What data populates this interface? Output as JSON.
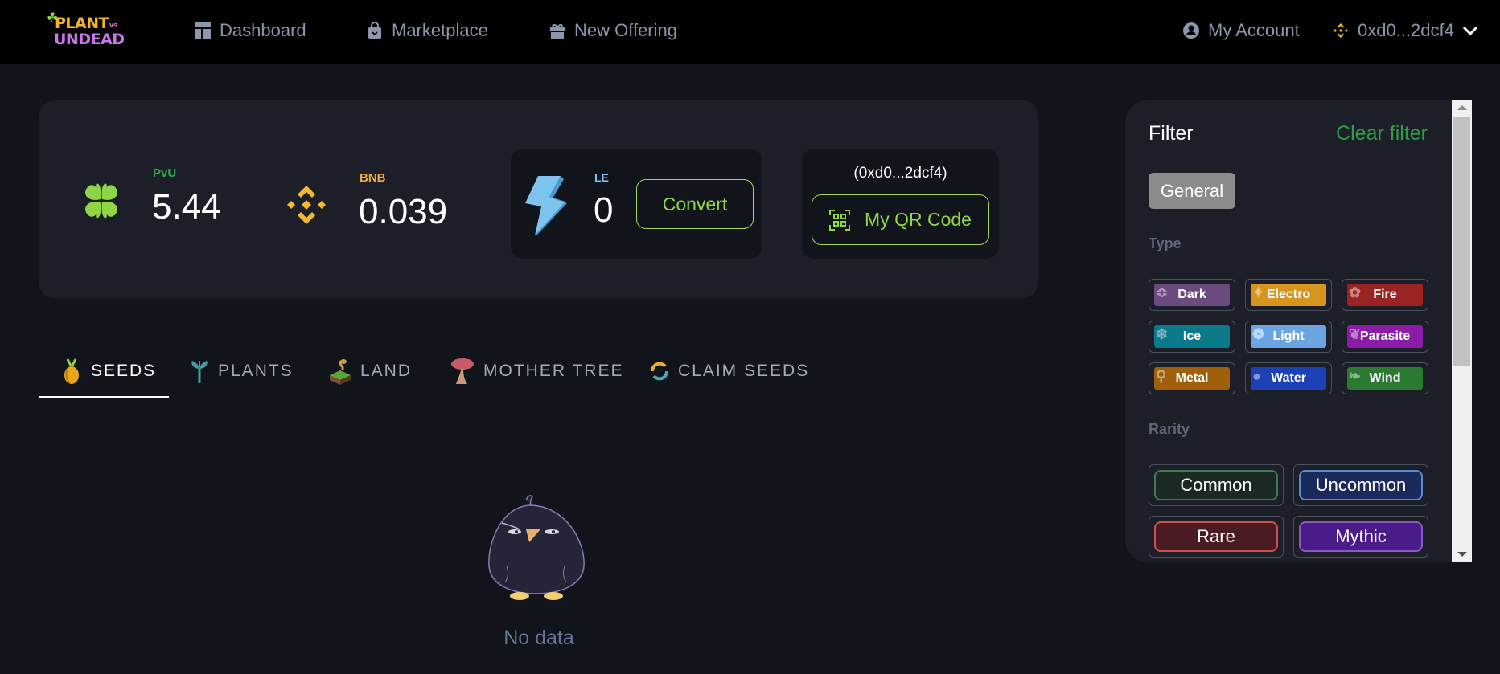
{
  "header": {
    "logo": {
      "line1": "PLANT",
      "vs": "vs",
      "line2": "UNDEAD"
    },
    "nav": [
      {
        "label": "Dashboard",
        "icon": "dashboard-icon"
      },
      {
        "label": "Marketplace",
        "icon": "shopping-bag-icon"
      },
      {
        "label": "New Offering",
        "icon": "gift-icon"
      }
    ],
    "account_label": "My Account",
    "wallet_address": "0xd0...2dcf4"
  },
  "stats": {
    "pvu": {
      "label": "PvU",
      "value": "5.44",
      "color": "#2fa84f"
    },
    "bnb": {
      "label": "BNB",
      "value": "0.039",
      "color": "#f0a93b"
    },
    "le": {
      "label": "LE",
      "value": "0",
      "color": "#7ec3f0"
    },
    "convert_label": "Convert",
    "qr": {
      "address": "(0xd0...2dcf4)",
      "button_label": "My QR Code"
    }
  },
  "tabs": [
    {
      "label": "SEEDS",
      "active": true
    },
    {
      "label": "PLANTS",
      "active": false
    },
    {
      "label": "LAND",
      "active": false
    },
    {
      "label": "MOTHER TREE",
      "active": false
    },
    {
      "label": "CLAIM SEEDS",
      "active": false
    }
  ],
  "empty_state": {
    "text": "No data"
  },
  "filter": {
    "title": "Filter",
    "clear_label": "Clear filter",
    "general_label": "General",
    "type_label": "Type",
    "types": [
      {
        "label": "Dark",
        "color": "#6b4a80"
      },
      {
        "label": "Electro",
        "color": "#d8951c"
      },
      {
        "label": "Fire",
        "color": "#9a2424"
      },
      {
        "label": "Ice",
        "color": "#0a7a8a"
      },
      {
        "label": "Light",
        "color": "#6ba4e0"
      },
      {
        "label": "Parasite",
        "color": "#8a1ca8"
      },
      {
        "label": "Metal",
        "color": "#a0600a"
      },
      {
        "label": "Water",
        "color": "#1c40b8"
      },
      {
        "label": "Wind",
        "color": "#2a7a32"
      }
    ],
    "rarity_label": "Rarity",
    "rarities": [
      {
        "label": "Common",
        "bg": "#1a2a22",
        "border": "#3f7a50"
      },
      {
        "label": "Uncommon",
        "bg": "#1a2a5a",
        "border": "#5a8ad0"
      },
      {
        "label": "Rare",
        "bg": "#4a1c22",
        "border": "#d05050"
      },
      {
        "label": "Mythic",
        "bg": "#4a1c8a",
        "border": "#8a5ac0"
      }
    ]
  }
}
